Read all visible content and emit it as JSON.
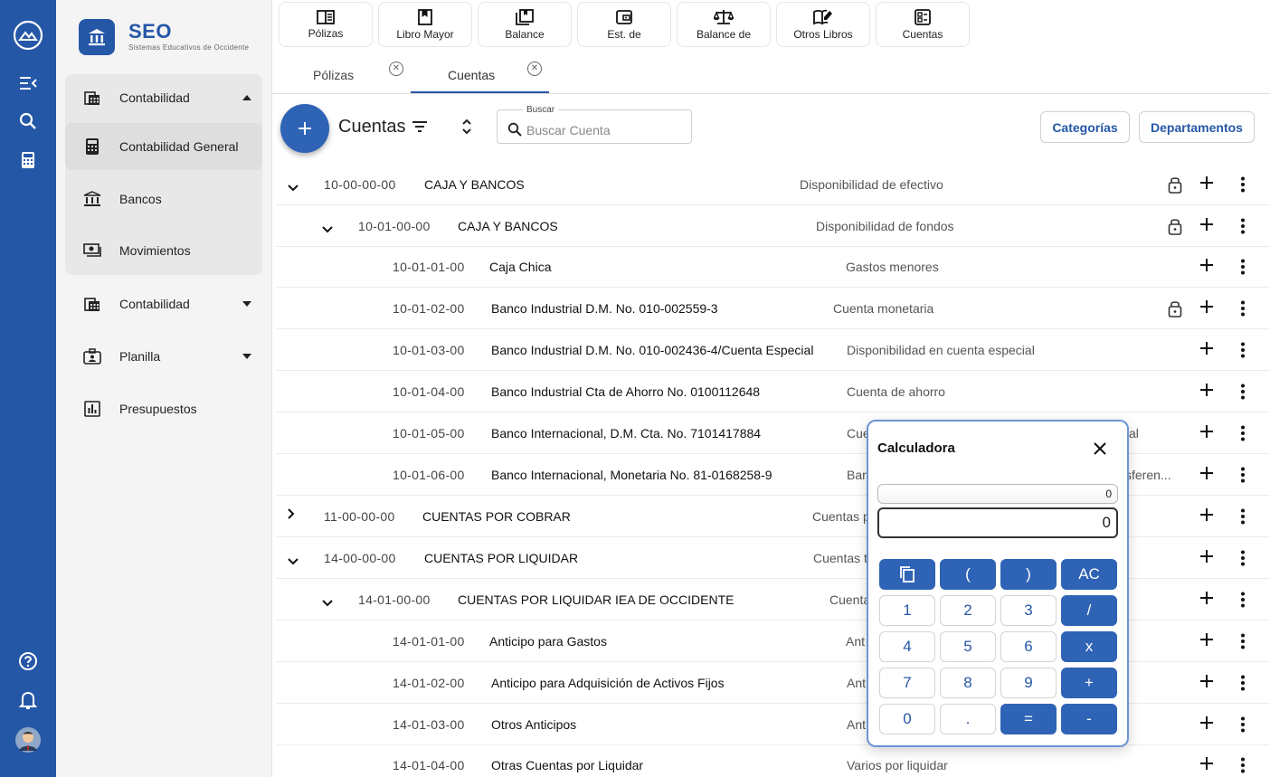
{
  "brand": {
    "title": "SEO",
    "subtitle": "Sistemas Educativos de Occidente"
  },
  "sidebar": {
    "items": [
      {
        "label": "Contabilidad"
      },
      {
        "label": "Contabilidad General"
      },
      {
        "label": "Bancos"
      },
      {
        "label": "Movimientos"
      },
      {
        "label": "Contabilidad"
      },
      {
        "label": "Planilla"
      },
      {
        "label": "Presupuestos"
      }
    ]
  },
  "toolbar": {
    "buttons": [
      {
        "label": "Pólizas"
      },
      {
        "label": "Libro Mayor"
      },
      {
        "label": "Balance"
      },
      {
        "label": "Est. de"
      },
      {
        "label": "Balance de"
      },
      {
        "label": "Otros Libros"
      },
      {
        "label": "Cuentas"
      }
    ]
  },
  "tabs": [
    {
      "label": "Pólizas"
    },
    {
      "label": "Cuentas"
    }
  ],
  "header": {
    "title": "Cuentas",
    "search_label": "Buscar",
    "search_placeholder": "Buscar Cuenta",
    "categorias_label": "Categorías",
    "departamentos_label": "Departamentos"
  },
  "accounts": [
    {
      "code": "10-00-00-00",
      "name": "CAJA Y BANCOS",
      "desc": "Disponibilidad de efectivo"
    },
    {
      "code": "10-01-00-00",
      "name": "CAJA Y BANCOS",
      "desc": "Disponibilidad de fondos"
    },
    {
      "code": "10-01-01-00",
      "name": "Caja Chica",
      "desc": "Gastos menores"
    },
    {
      "code": "10-01-02-00",
      "name": "Banco Industrial D.M. No. 010-002559-3",
      "desc": "Cuenta monetaria"
    },
    {
      "code": "10-01-03-00",
      "name": "Banco Industrial D.M. No. 010-002436-4/Cuenta Especial",
      "desc": "Disponibilidad en cuenta especial"
    },
    {
      "code": "10-01-04-00",
      "name": "Banco Industrial Cta de Ahorro No. 0100112648",
      "desc": "Cuenta de ahorro"
    },
    {
      "code": "10-01-05-00",
      "name": "Banco Internacional, D.M. Cta. No. 7101417884",
      "desc": "Cue",
      "desc_tail": "al"
    },
    {
      "code": "10-01-06-00",
      "name": "Banco Internacional, Monetaria No. 81-0168258-9",
      "desc": "Bar",
      "desc_tail": "sferen..."
    },
    {
      "code": "11-00-00-00",
      "name": "CUENTAS POR COBRAR",
      "desc": "Cuentas p"
    },
    {
      "code": "14-00-00-00",
      "name": "CUENTAS POR LIQUIDAR",
      "desc": "Cuentas t"
    },
    {
      "code": "14-01-00-00",
      "name": "CUENTAS POR LIQUIDAR IEA DE OCCIDENTE",
      "desc": "Cuenta"
    },
    {
      "code": "14-01-01-00",
      "name": "Anticipo para Gastos",
      "desc": "Ant"
    },
    {
      "code": "14-01-02-00",
      "name": "Anticipo para Adquisición de Activos Fijos",
      "desc": "Ant"
    },
    {
      "code": "14-01-03-00",
      "name": "Otros Anticipos",
      "desc": "Ant"
    },
    {
      "code": "14-01-04-00",
      "name": "Otras Cuentas por Liquidar",
      "desc": "Varios por liquidar"
    }
  ],
  "calculator": {
    "title": "Calculadora",
    "expression": "0",
    "display": "0",
    "keys": [
      "(",
      ")",
      "AC",
      "1",
      "2",
      "3",
      "/",
      "4",
      "5",
      "6",
      "x",
      "7",
      "8",
      "9",
      "+",
      "0",
      ".",
      "=",
      "-"
    ]
  },
  "colors": {
    "primary": "#2557a7",
    "accent": "#2f63b5"
  }
}
